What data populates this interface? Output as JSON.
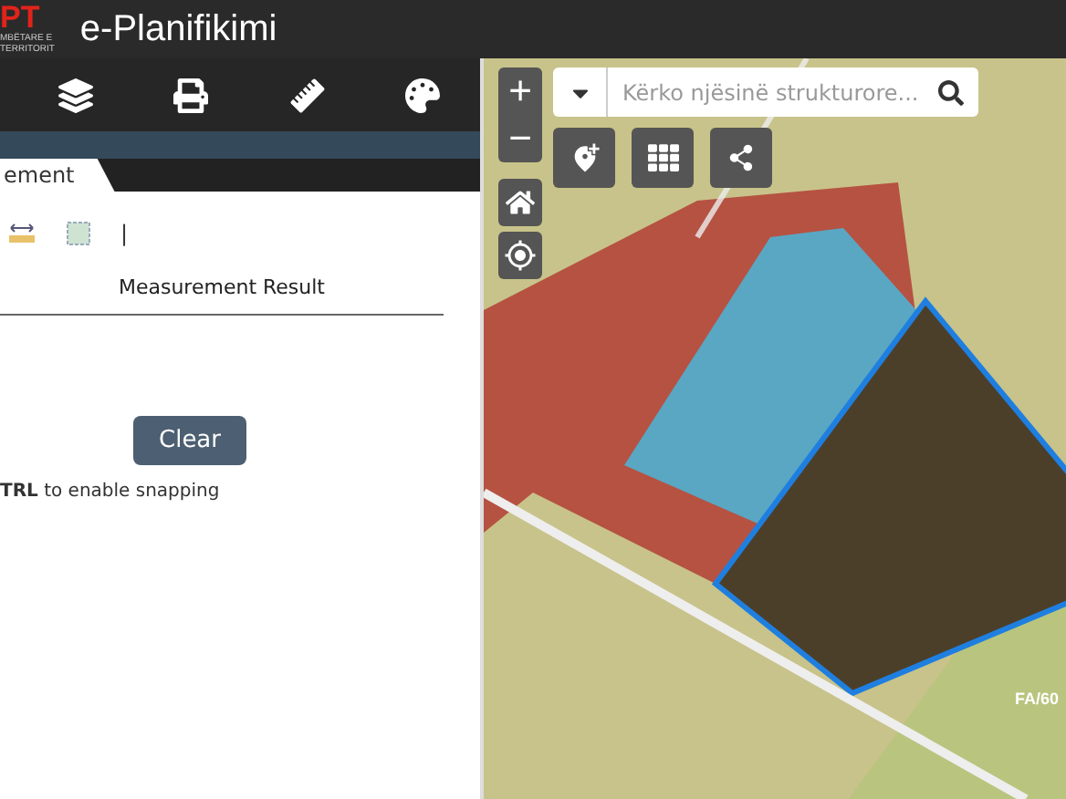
{
  "header": {
    "logo_mark": "PT",
    "logo_lines": [
      "MBËTARE E",
      "TERRITORIT"
    ],
    "title": "e-Planifikimi"
  },
  "toolbar": [
    {
      "kind": "layers"
    },
    {
      "kind": "print"
    },
    {
      "kind": "ruler"
    },
    {
      "kind": "palette"
    }
  ],
  "panel": {
    "tabs": [
      {
        "label": "ement",
        "selected": true
      }
    ],
    "tools": [
      {
        "kind": "distance"
      },
      {
        "kind": "area"
      }
    ],
    "separator": "|",
    "result_title": "Measurement Result",
    "clear_button": "Clear",
    "hint": "**TRL** to enable snapping"
  },
  "map": {
    "zoom_in": "+",
    "zoom_out": "−",
    "search_placeholder": "Kërko njësinë strukturore...",
    "actions": [
      {
        "kind": "add-map"
      },
      {
        "kind": "grid"
      },
      {
        "kind": "share"
      }
    ],
    "parcel_label": "FA/60"
  }
}
